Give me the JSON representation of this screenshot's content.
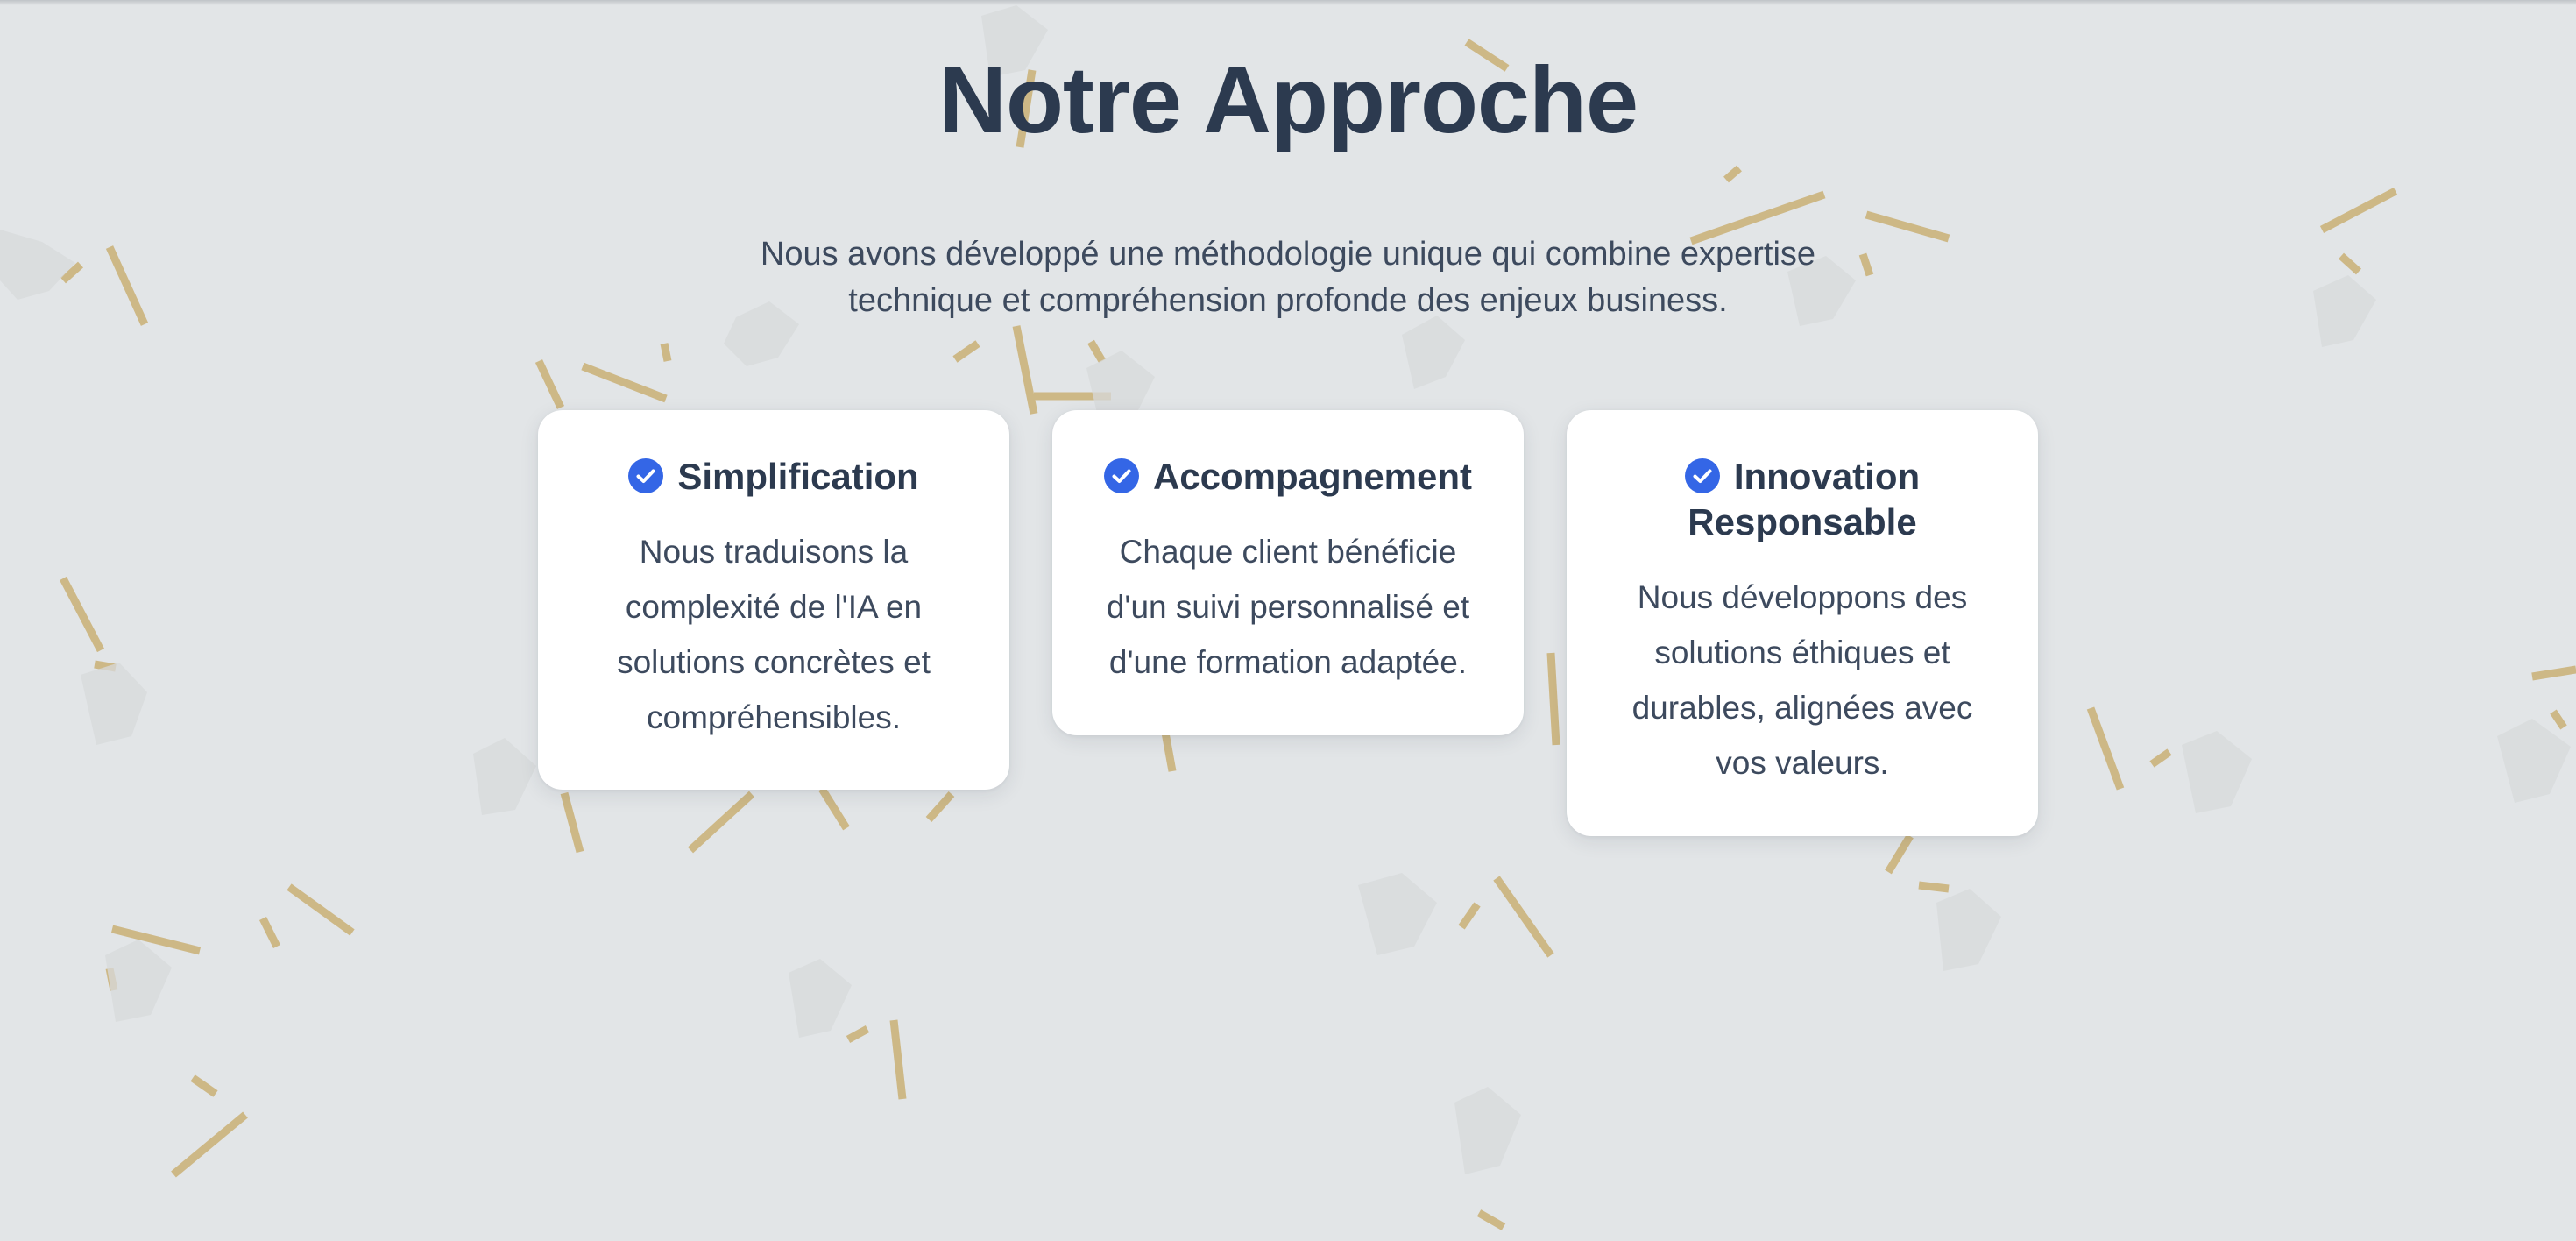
{
  "section": {
    "title": "Notre Approche",
    "intro_line1": "Nous avons développé une méthodologie unique qui combine expertise",
    "intro_line2": "technique et compréhension profonde des enjeux business."
  },
  "cards": [
    {
      "icon": "check-circle-icon",
      "title": "Simplification",
      "text_lines": [
        "Nous traduisons la",
        "complexité de l'IA en",
        "solutions concrètes et",
        "compréhensibles."
      ]
    },
    {
      "icon": "check-circle-icon",
      "title": "Accompagnement",
      "text_lines": [
        "Chaque client bénéficie",
        "d'un suivi personnalisé et",
        "d'une formation adaptée."
      ]
    },
    {
      "icon": "check-circle-icon",
      "title_lines": [
        "Innovation",
        "Responsable"
      ],
      "text_lines": [
        "Nous développons des",
        "solutions éthiques et",
        "durables, alignées avec",
        "vos valeurs."
      ]
    }
  ],
  "colors": {
    "background": "#e2e5e7",
    "heading": "#2c3a4f",
    "body_text": "#3d4a5e",
    "accent_check": "#3466e6",
    "decor_gold": "#c9ad6e",
    "card_background": "#ffffff"
  }
}
